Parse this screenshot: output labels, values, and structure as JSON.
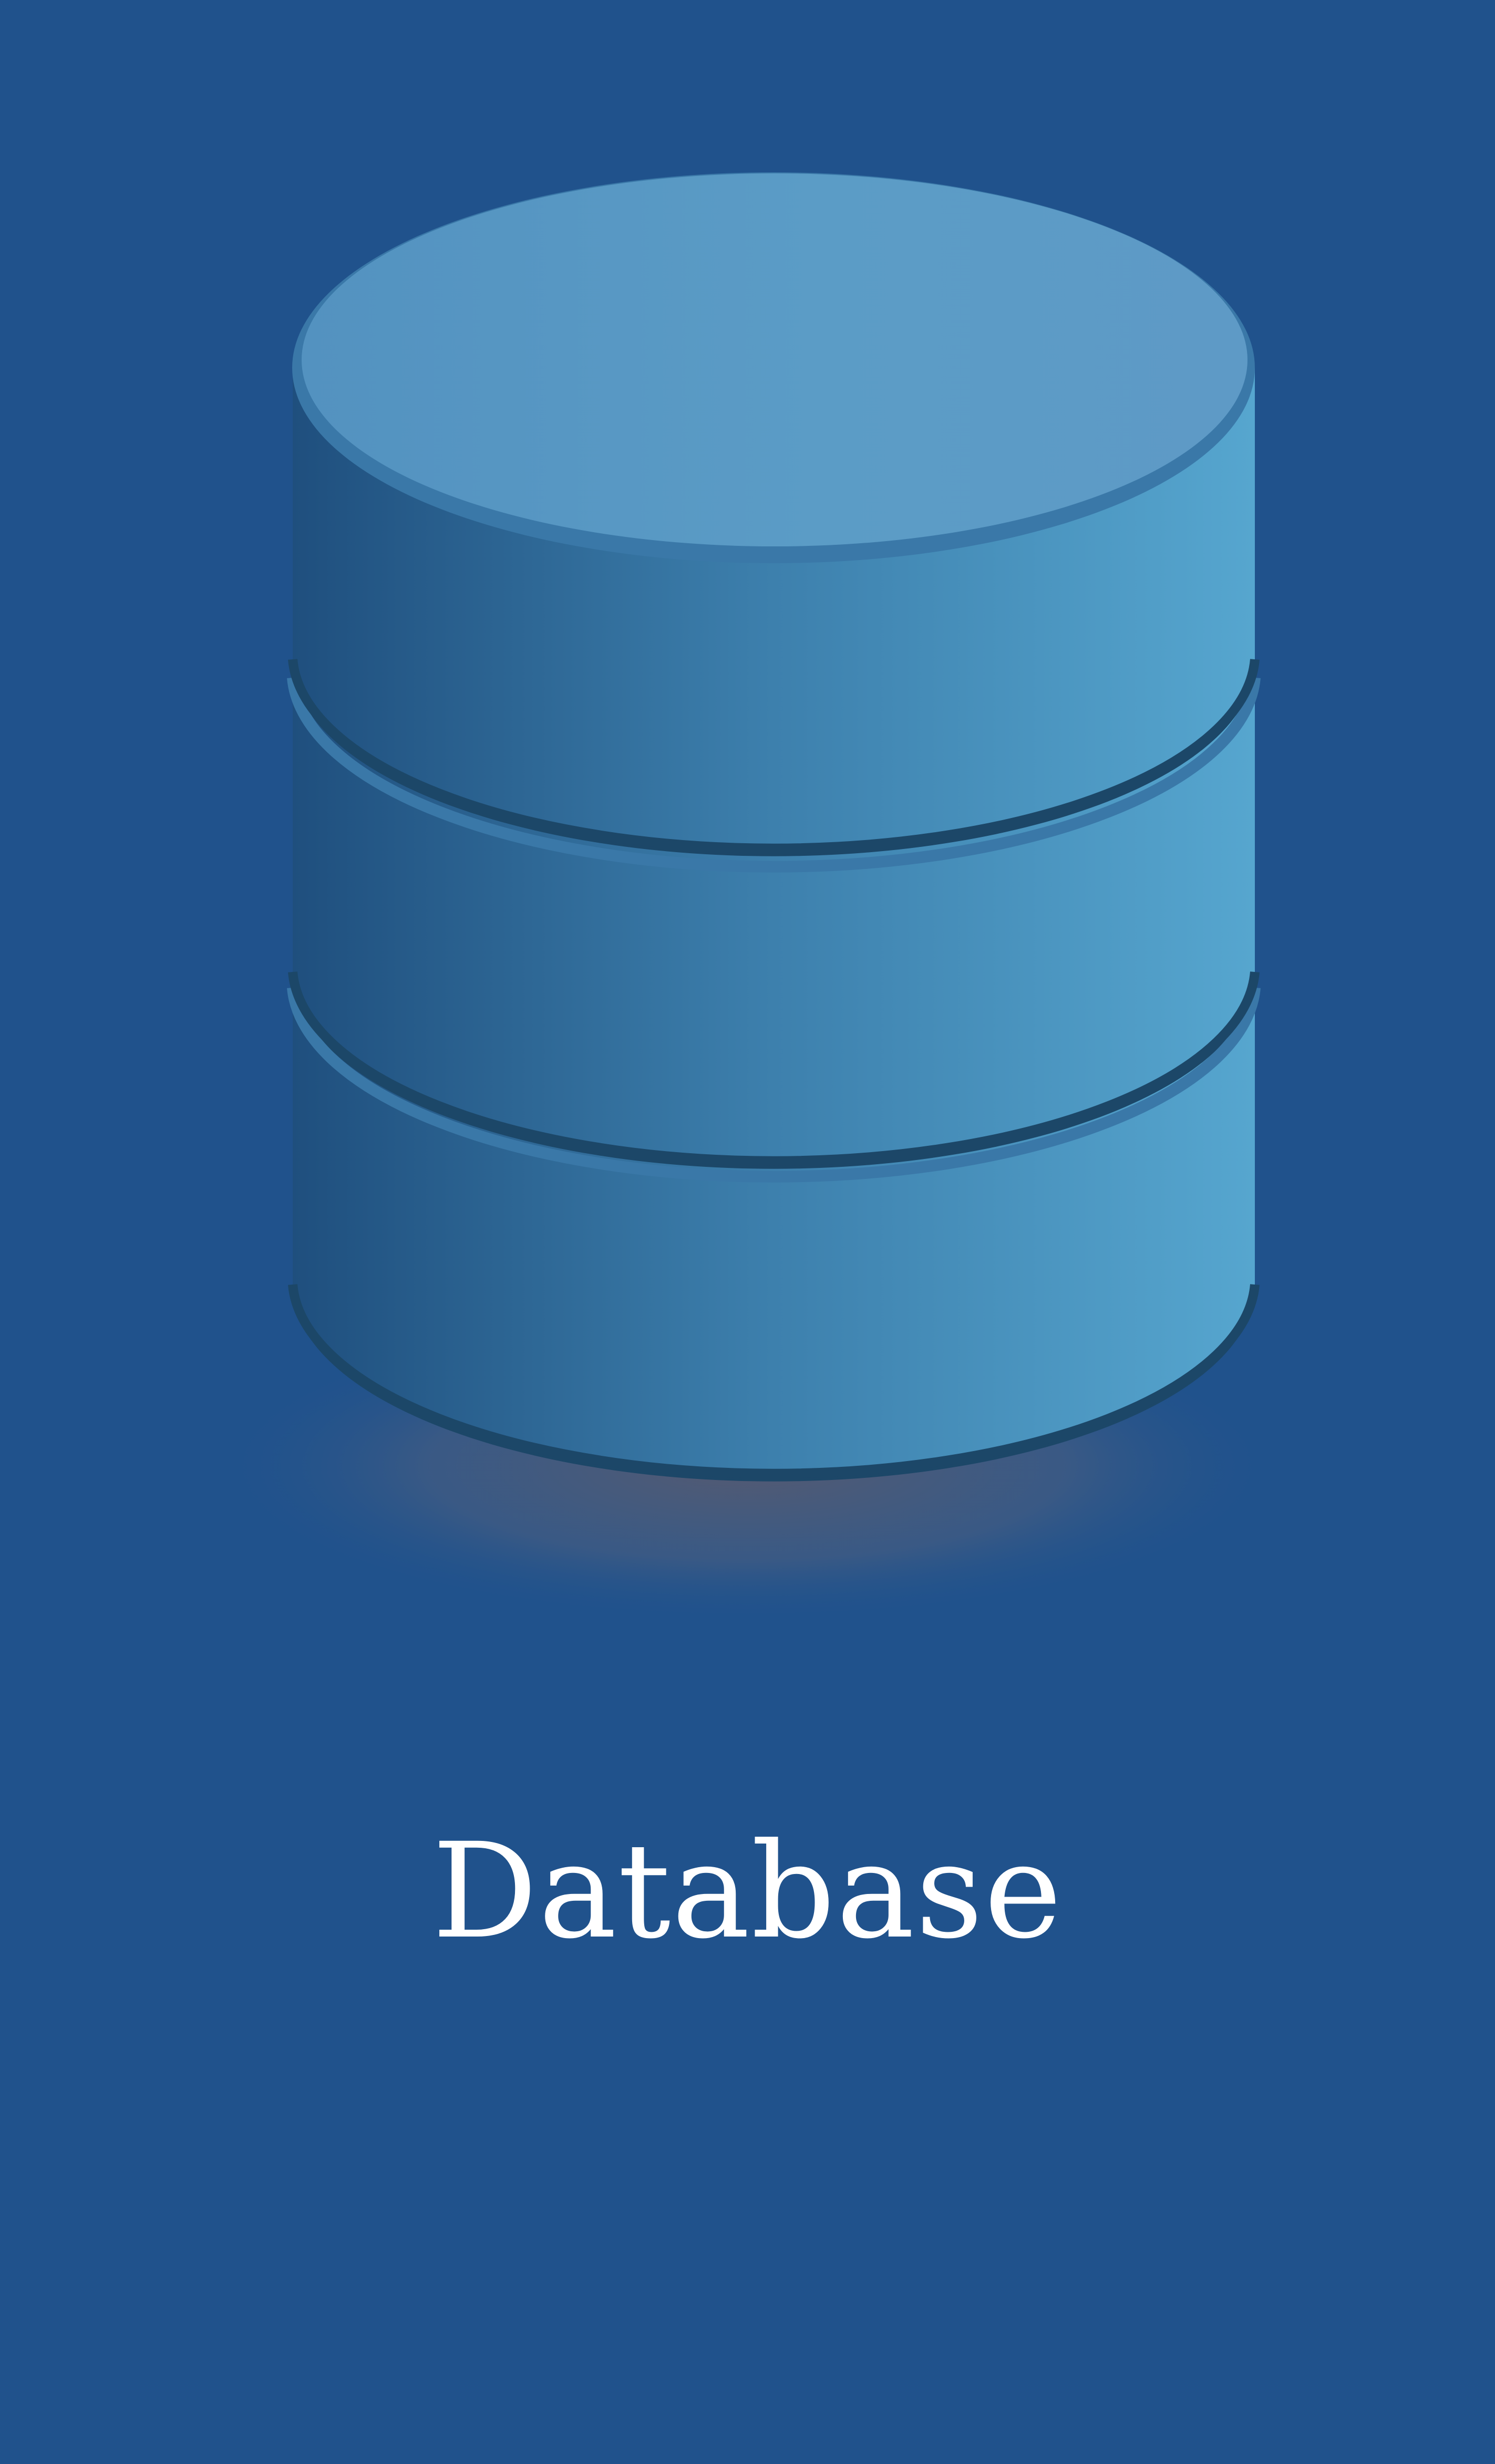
{
  "diagram": {
    "label": "Database",
    "icon": "database-cylinder-icon"
  },
  "colors": {
    "background": "#20528c",
    "top_face": "#5a9bc5",
    "body_left": "#1f4f7e",
    "body_right": "#56a6cf",
    "rim": "#3a78a8",
    "groove": "#1c4768",
    "label": "#ffffff"
  }
}
